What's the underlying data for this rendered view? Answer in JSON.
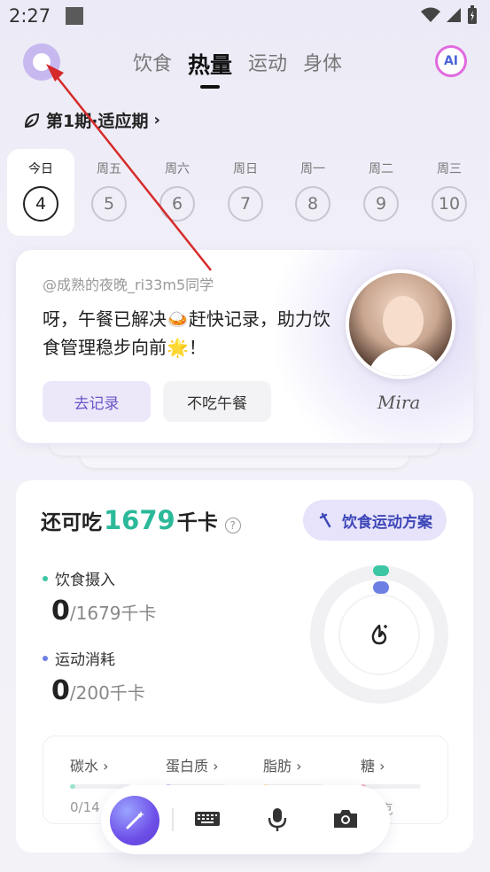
{
  "status": {
    "time": "2:27"
  },
  "header": {
    "tabs": [
      {
        "label": "饮食",
        "active": false
      },
      {
        "label": "热量",
        "active": true
      },
      {
        "label": "运动",
        "active": false
      },
      {
        "label": "身体",
        "active": false
      }
    ],
    "ai_label": "AI"
  },
  "phase": {
    "label": "第1期·适应期"
  },
  "days": [
    {
      "label": "今日",
      "num": "4",
      "active": true
    },
    {
      "label": "周五",
      "num": "5",
      "active": false
    },
    {
      "label": "周六",
      "num": "6",
      "active": false
    },
    {
      "label": "周日",
      "num": "7",
      "active": false
    },
    {
      "label": "周一",
      "num": "8",
      "active": false
    },
    {
      "label": "周二",
      "num": "9",
      "active": false
    },
    {
      "label": "周三",
      "num": "10",
      "active": false
    }
  ],
  "message": {
    "mention": "@成熟的夜晚_ri33m5同学",
    "text": "呀，午餐已解决🍛赶快记录，助力饮食管理稳步向前🌟！",
    "record_button": "去记录",
    "skip_button": "不吃午餐",
    "signature": "Mira"
  },
  "calories": {
    "prefix": "还可吃",
    "value": "1679",
    "unit": "千卡",
    "help": "?",
    "plan_button": "饮食运动方案",
    "intake_label": "饮食摄入",
    "intake_value": "0",
    "intake_total": "/1679千卡",
    "burn_label": "运动消耗",
    "burn_value": "0",
    "burn_total": "/200千卡",
    "intake_color": "#3cc6a4",
    "burn_color": "#6e7fe3"
  },
  "macros": [
    {
      "label": "碳水",
      "value": "0/14",
      "color": "#9be3cf"
    },
    {
      "label": "蛋白质",
      "value": "",
      "color": "#b9c3f2"
    },
    {
      "label": "脂肪",
      "value": "",
      "color": "#f2dfa0"
    },
    {
      "label": "糖",
      "value": "0克",
      "color": "#f2b8c6"
    }
  ]
}
